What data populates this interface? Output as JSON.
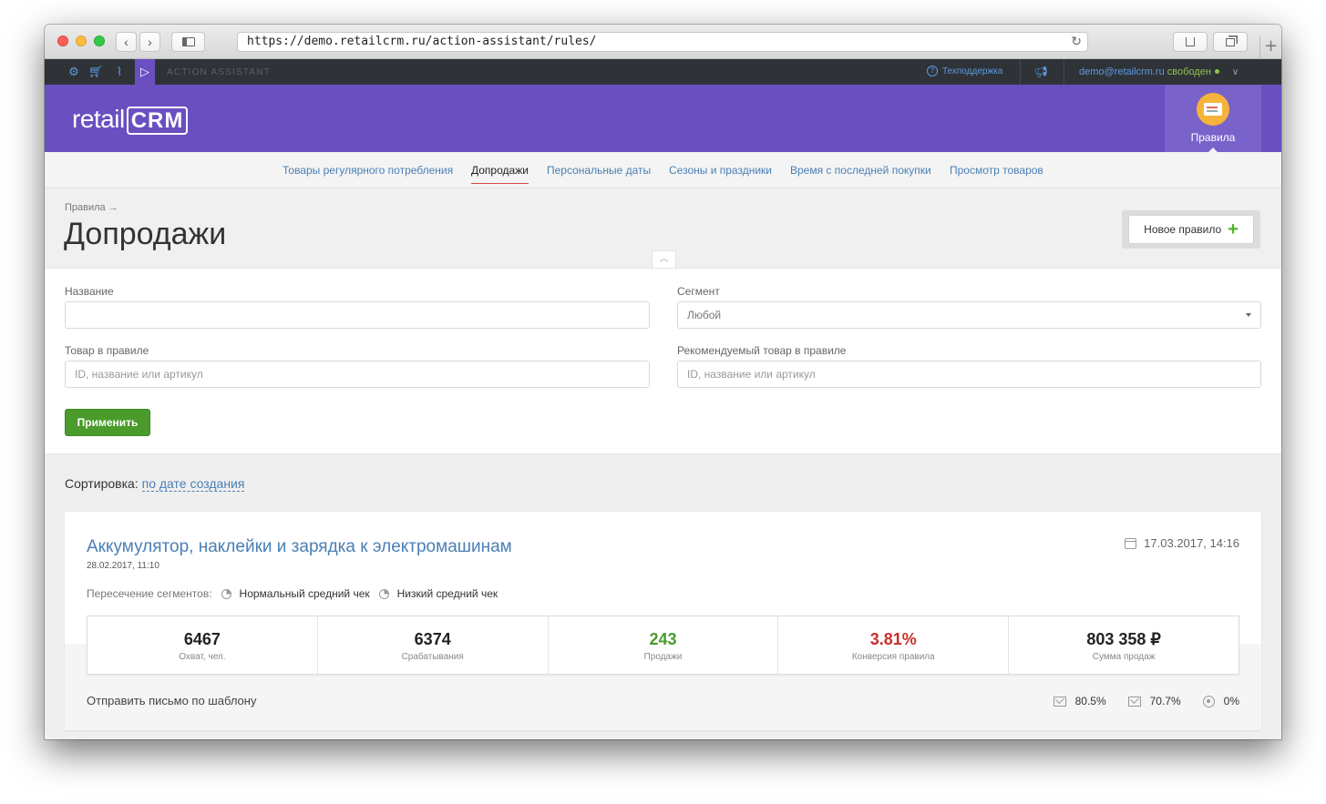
{
  "browser": {
    "url": "https://demo.retailcrm.ru/action-assistant/rules/"
  },
  "appbar": {
    "section_label": "ACTION ASSISTANT",
    "support_label": "Техподдержка",
    "user_email": "demo@retailcrm.ru",
    "user_status": "свободен",
    "icons": [
      "gear-icon",
      "cart-icon",
      "chart-icon",
      "action-assistant-icon",
      "help-icon",
      "megaphone-icon",
      "chevron-down-icon"
    ]
  },
  "header": {
    "logo_text": "retail",
    "logo_crm": "CRM",
    "rules_tab_label": "Правила"
  },
  "subnav": {
    "items": [
      {
        "label": "Товары регулярного потребления",
        "active": false
      },
      {
        "label": "Допродажи",
        "active": true
      },
      {
        "label": "Персональные даты",
        "active": false
      },
      {
        "label": "Сезоны и праздники",
        "active": false
      },
      {
        "label": "Время с последней покупки",
        "active": false
      },
      {
        "label": "Просмотр товаров",
        "active": false
      }
    ]
  },
  "page": {
    "breadcrumb": "Правила →",
    "title": "Допродажи",
    "new_rule_label": "Новое правило"
  },
  "filters": {
    "name_label": "Название",
    "name_value": "",
    "segment_label": "Сегмент",
    "segment_value": "Любой",
    "product_label": "Товар в правиле",
    "product_placeholder": "ID, название или артикул",
    "recommended_label": "Рекомендуемый товар в правиле",
    "recommended_placeholder": "ID, название или артикул",
    "apply_label": "Применить"
  },
  "sorting": {
    "label": "Сортировка:",
    "value": "по дате создания"
  },
  "rule_card": {
    "title": "Аккумулятор, наклейки и зарядка к электромашинам",
    "created": "28.02.2017, 11:10",
    "updated": "17.03.2017, 14:16",
    "segments_label": "Пересечение сегментов:",
    "segments": [
      "Нормальный средний чек",
      "Низкий средний чек"
    ],
    "stats": [
      {
        "value": "6467",
        "label": "Охват, чел.",
        "color": "default"
      },
      {
        "value": "6374",
        "label": "Срабатывания",
        "color": "default"
      },
      {
        "value": "243",
        "label": "Продажи",
        "color": "green"
      },
      {
        "value": "3.81%",
        "label": "Конверсия правила",
        "color": "red"
      },
      {
        "value": "803 358 ₽",
        "label": "Сумма продаж",
        "color": "default"
      }
    ],
    "action_label": "Отправить письмо по шаблону",
    "metrics": [
      {
        "icon": "envelope-icon",
        "value": "80.5%"
      },
      {
        "icon": "envelope-open-icon",
        "value": "70.7%"
      },
      {
        "icon": "target-icon",
        "value": "0%"
      }
    ]
  }
}
